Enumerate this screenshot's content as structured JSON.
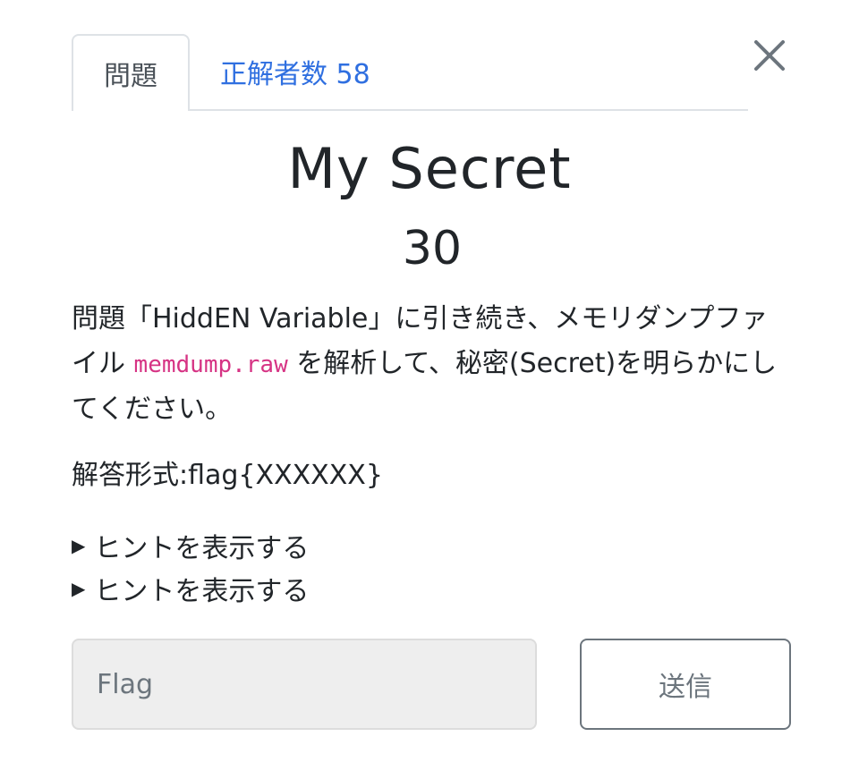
{
  "tabs": {
    "problem_label": "問題",
    "solvers_label": "正解者数 58"
  },
  "challenge": {
    "title": "My Secret",
    "points": "30",
    "description_part1": "問題「HiddEN Variable」に引き続き、メモリダンプファイル ",
    "filename": "memdump.raw",
    "description_part2": " を解析して、秘密(Secret)を明らかにしてください。",
    "answer_format": "解答形式:flag{XXXXXX}"
  },
  "hints": [
    {
      "label": "ヒントを表示する"
    },
    {
      "label": "ヒントを表示する"
    }
  ],
  "form": {
    "flag_placeholder": "Flag",
    "submit_label": "送信"
  },
  "icons": {
    "close": "close-icon",
    "hint_toggle": "triangle-right-icon"
  },
  "colors": {
    "link_blue": "#2f6fe0",
    "code_pink": "#d63384"
  }
}
